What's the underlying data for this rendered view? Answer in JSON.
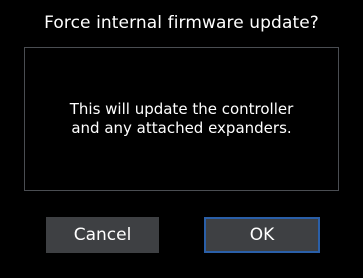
{
  "dialog": {
    "title": "Force internal firmware update?",
    "message_lines": [
      "This will update the controller",
      "and any attached expanders."
    ],
    "buttons": {
      "cancel_label": "Cancel",
      "ok_label": "OK"
    },
    "colors": {
      "background": "#000000",
      "button_fill": "#3e4043",
      "focus_border": "#2a5fa8",
      "message_border": "#4a4d52",
      "text": "#ffffff"
    }
  }
}
